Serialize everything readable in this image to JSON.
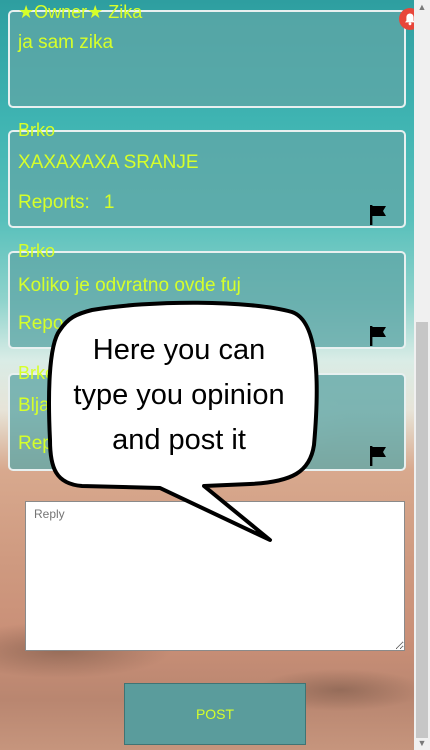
{
  "comments": [
    {
      "author": "★Owner★ Zika",
      "text": "ja sam zika"
    },
    {
      "author": "Brko",
      "text": "XAXAXAXA SRANJE",
      "reports_label": "Reports:",
      "reports_count": "1"
    },
    {
      "author": "Brko",
      "text": "Koliko je odvratno ovde fuj",
      "reports_label": "Repo"
    },
    {
      "author": "Brko",
      "text": "Blja",
      "reports_label": "Rep"
    }
  ],
  "reply": {
    "placeholder": "Reply"
  },
  "post_button": {
    "label": "POST"
  },
  "tooltip": {
    "line1": "Here you can",
    "line2": "type you opinion",
    "line3": "and post it"
  },
  "icons": {
    "notification": "bell-icon",
    "report": "flag-icon"
  },
  "colors": {
    "accent_text": "#d6ff2a",
    "panel": "#5fa6a6",
    "bell": "#e8463a"
  }
}
